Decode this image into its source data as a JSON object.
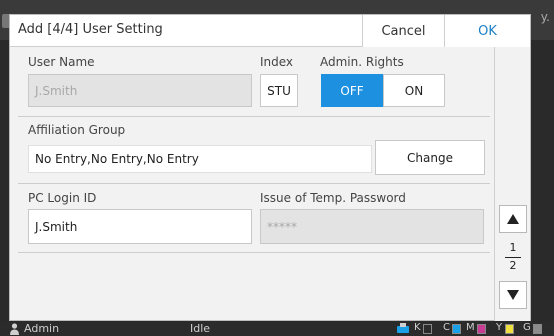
{
  "background": {
    "right_text": "y."
  },
  "dialog": {
    "title": "Add [4/4] User Setting",
    "cancel_label": "Cancel",
    "ok_label": "OK",
    "user_name_label": "User Name",
    "user_name_value": "J.Smith",
    "index_label": "Index",
    "index_value": "STU",
    "admin_rights_label": "Admin. Rights",
    "admin_off_label": "OFF",
    "admin_on_label": "ON",
    "admin_rights_selected": "OFF",
    "affiliation_label": "Affiliation Group",
    "affiliation_value": "No Entry,No Entry,No Entry",
    "change_label": "Change",
    "pc_login_label": "PC Login ID",
    "pc_login_value": "J.Smith",
    "temp_password_label": "Issue of Temp. Password",
    "temp_password_value": "*****",
    "page_current": "1",
    "page_total": "2"
  },
  "statusbar": {
    "user": "Admin",
    "state": "Idle",
    "inks": [
      "K",
      "C",
      "M",
      "Y",
      "G"
    ]
  },
  "colors": {
    "accent": "#1e90e0",
    "ok_text": "#1a7fc6",
    "ink_c": "#1aa0e6",
    "ink_m": "#c83c96",
    "ink_y": "#f0e040",
    "ink_g": "#8c8c8c"
  }
}
